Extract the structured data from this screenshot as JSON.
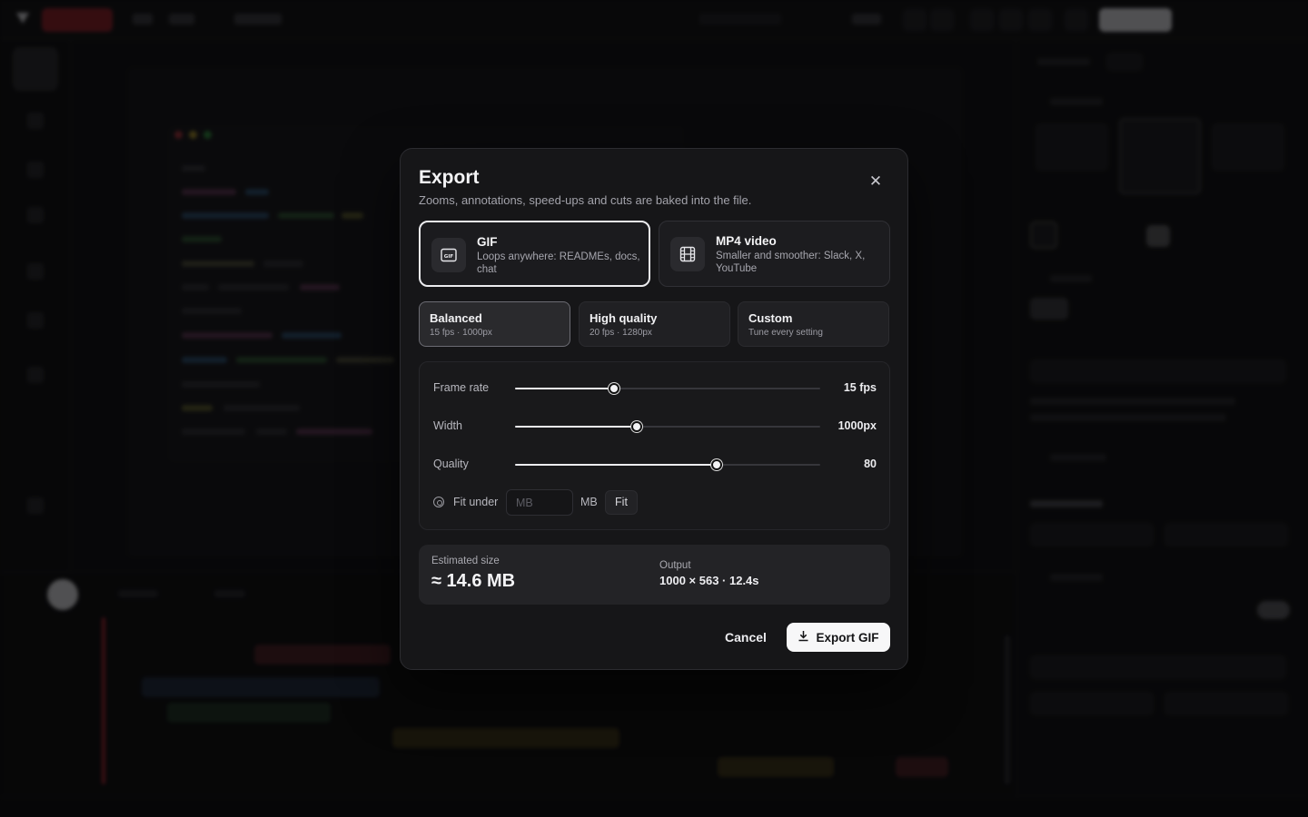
{
  "modal": {
    "title": "Export",
    "subtitle": "Zooms, annotations, speed-ups and cuts are baked into the file.",
    "close_icon": "close-icon"
  },
  "formats": [
    {
      "name": "GIF",
      "description": "Loops anywhere: READMEs, docs, chat",
      "icon": "gif-icon",
      "selected": true
    },
    {
      "name": "MP4 video",
      "description": "Smaller and smoother: Slack, X, YouTube",
      "icon": "film-icon",
      "selected": false
    }
  ],
  "presets": [
    {
      "name": "Balanced",
      "description": "15 fps · 1000px",
      "selected": true
    },
    {
      "name": "High quality",
      "description": "20 fps · 1280px",
      "selected": false
    },
    {
      "name": "Custom",
      "description": "Tune every setting",
      "selected": false
    }
  ],
  "settings": {
    "frame_rate": {
      "label": "Frame rate",
      "value": "15 fps",
      "level": 0.325
    },
    "width": {
      "label": "Width",
      "value": "1000px",
      "level": 0.4
    },
    "quality": {
      "label": "Quality",
      "value": "80",
      "level": 0.66
    }
  },
  "fit": {
    "label": "Fit under",
    "placeholder": "MB",
    "value": "",
    "unit": "MB",
    "button": "Fit"
  },
  "summary": {
    "estimated_label": "Estimated size",
    "estimated_value": "≈ 14.6 MB",
    "output_label": "Output",
    "output_value": "1000 × 563 · 12.4s"
  },
  "actions": {
    "cancel": "Cancel",
    "export": "Export GIF"
  },
  "colors": {
    "modal_bg": "#161618",
    "accent": "#f7f7f8",
    "record_red": "#8e1f28"
  }
}
